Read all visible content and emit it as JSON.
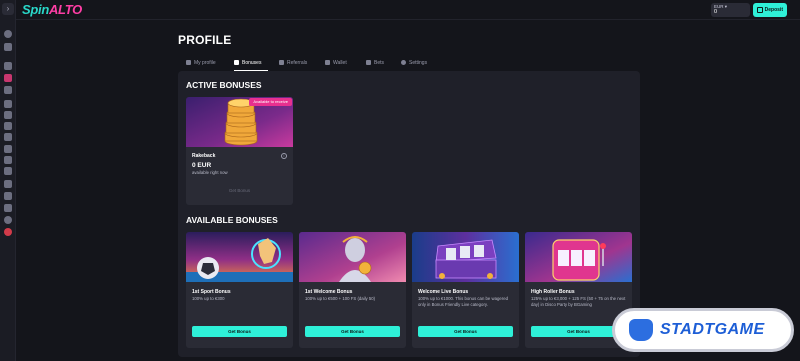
{
  "app": {
    "logo_part1": "Spin",
    "logo_part2": "ALTO"
  },
  "header": {
    "balance_currency": "EUR ▾",
    "balance_value": "0",
    "deposit_label": "Deposit"
  },
  "page": {
    "title": "PROFILE"
  },
  "tabs": [
    {
      "label": "My profile",
      "icon": "user-icon"
    },
    {
      "label": "Bonuses",
      "icon": "gift-icon"
    },
    {
      "label": "Referrals",
      "icon": "megaphone-icon"
    },
    {
      "label": "Wallet",
      "icon": "wallet-icon"
    },
    {
      "label": "Bets",
      "icon": "coins-icon"
    },
    {
      "label": "Settings",
      "icon": "gear-icon"
    }
  ],
  "active_tab": "Bonuses",
  "active_bonuses": {
    "heading": "ACTIVE BONUSES",
    "cards": [
      {
        "badge": "Available to receive",
        "name": "Rakeback",
        "amount": "0 EUR",
        "note": "available right now",
        "button": "Get Bonus",
        "button_enabled": false
      }
    ]
  },
  "available_bonuses": {
    "heading": "AVAILABLE BONUSES",
    "cards": [
      {
        "name": "1st Sport Bonus",
        "description": "100% up to €300",
        "button": "Get Bonus"
      },
      {
        "name": "1st Welcome Bonus",
        "description": "100% up to €500 + 100 FS (daily 50)",
        "button": "Get Bonus"
      },
      {
        "name": "Welcome Live Bonus",
        "description": "100% up to €1000. This bonus can be wagered only in Bonus Friendly Live category.",
        "button": "Get Bonus"
      },
      {
        "name": "High Roller Bonus",
        "description": "125% up to €3,000 + 125 FS (50 + 75 on the next day) in Disco Party by BGaming",
        "button": "Get Bonus"
      }
    ]
  },
  "watermark": {
    "text": "STADTGAME"
  },
  "colors": {
    "accent": "#2ef0d8",
    "brand_pink": "#ff3ea5",
    "badge": "#e8308f",
    "panel": "#1f2029",
    "card": "#2a2b35"
  }
}
